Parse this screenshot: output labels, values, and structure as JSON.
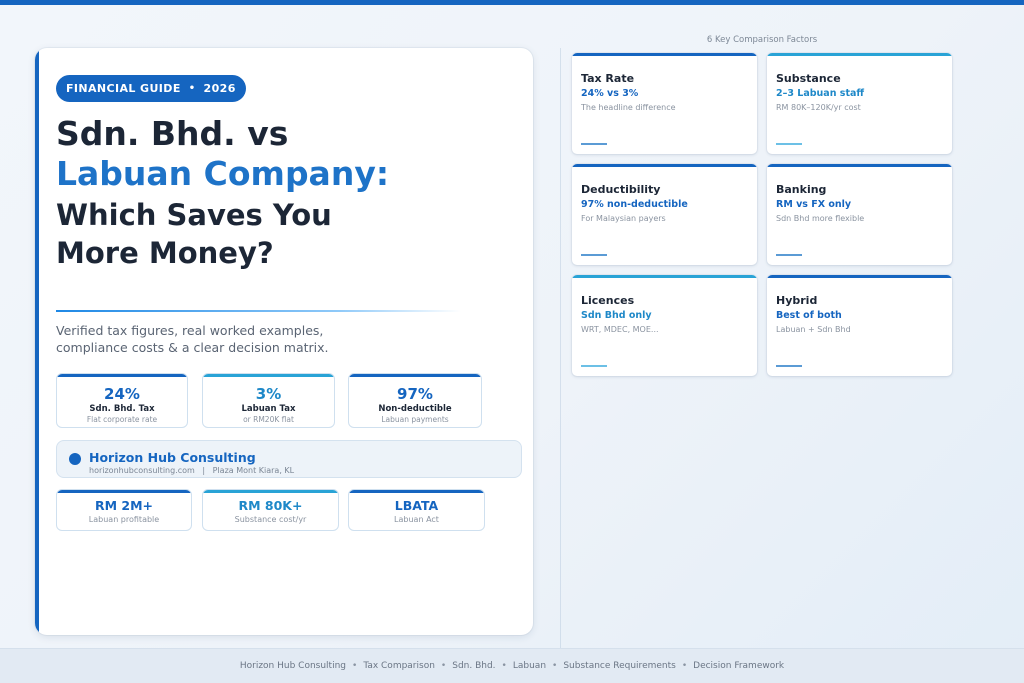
{
  "hero": {
    "badge_left": "FINANCIAL GUIDE",
    "badge_sep": "•",
    "badge_right": "2026",
    "title_line1": "Sdn. Bhd. vs",
    "title_line2": "Labuan Company:",
    "title_line3": "Which Saves You",
    "title_line4": "More Money?",
    "subtitle": "Verified tax figures, real worked examples, compliance costs & a clear decision matrix."
  },
  "stats": [
    {
      "value": "24%",
      "label": "Sdn. Bhd. Tax",
      "sub": "Flat corporate rate",
      "color": "#1565c0"
    },
    {
      "value": "3%",
      "label": "Labuan Tax",
      "sub": "or RM20K flat",
      "color": "#1e88c8"
    },
    {
      "value": "97%",
      "label": "Non-deductible",
      "sub": "Labuan payments",
      "color": "#1565c0"
    }
  ],
  "consultant": {
    "name": "Horizon Hub Consulting",
    "website": "horizonhubconsulting.com",
    "sep": "|",
    "location": "Plaza Mont Kiara, KL"
  },
  "stats2": [
    {
      "value": "RM 2M+",
      "sub": "Labuan profitable",
      "color": "#1565c0"
    },
    {
      "value": "RM 80K+",
      "sub": "Substance cost/yr",
      "color": "#29a3d6"
    },
    {
      "value": "LBATA",
      "sub": "Labuan Act",
      "color": "#1565c0"
    }
  ],
  "factors_heading": "6 Key Comparison Factors",
  "factors": [
    {
      "title": "Tax Rate",
      "value": "24% vs 3%",
      "sub": "The headline difference",
      "accent": "#1565c0",
      "value_color": "#1565c0"
    },
    {
      "title": "Substance",
      "value": "2–3 Labuan staff",
      "sub": "RM 80K–120K/yr cost",
      "accent": "#29a3d6",
      "value_color": "#1e88c8"
    },
    {
      "title": "Deductibility",
      "value": "97% non-deductible",
      "sub": "For Malaysian payers",
      "accent": "#1565c0",
      "value_color": "#1565c0"
    },
    {
      "title": "Banking",
      "value": "RM vs FX only",
      "sub": "Sdn Bhd more flexible",
      "accent": "#1565c0",
      "value_color": "#1565c0"
    },
    {
      "title": "Licences",
      "value": "Sdn Bhd only",
      "sub": "WRT, MDEC, MOE...",
      "accent": "#29a3d6",
      "value_color": "#1e88c8"
    },
    {
      "title": "Hybrid",
      "value": "Best of both",
      "sub": "Labuan + Sdn Bhd",
      "accent": "#1565c0",
      "value_color": "#1565c0"
    }
  ],
  "footer": {
    "items": [
      "Horizon Hub Consulting",
      "Tax Comparison",
      "Sdn. Bhd.",
      "Labuan",
      "Substance Requirements",
      "Decision Framework"
    ],
    "sep": "•"
  }
}
